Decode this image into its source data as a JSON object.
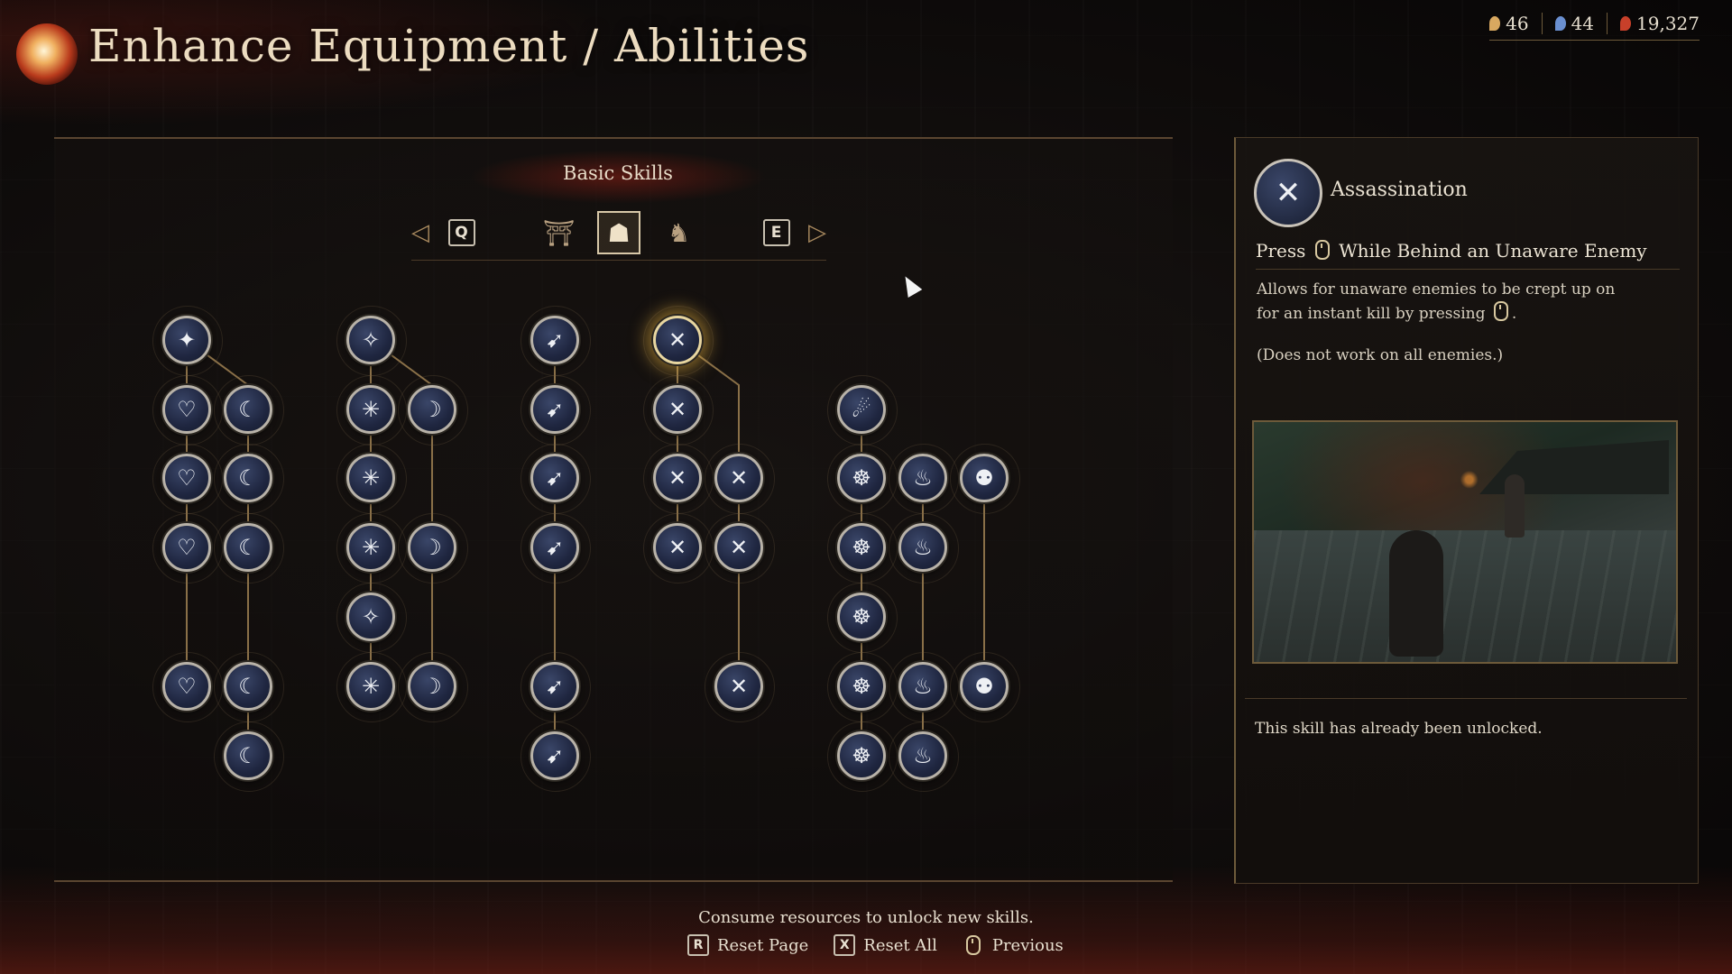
{
  "header": {
    "title": "Enhance Equipment / Abilities",
    "resources": [
      {
        "icon": "key-resource-icon",
        "value": "46",
        "color": "#d9a860"
      },
      {
        "icon": "blue-flame-resource-icon",
        "value": "44",
        "color": "#6a8fd0"
      },
      {
        "icon": "red-crystal-resource-icon",
        "value": "19,327",
        "color": "#c8402a"
      }
    ]
  },
  "skills": {
    "section_title": "Basic Skills",
    "tabs": {
      "prev_key": "Q",
      "next_key": "E",
      "items": [
        {
          "name": "tab-forge",
          "glyph": "⛩"
        },
        {
          "name": "tab-ninja",
          "glyph": "☗"
        },
        {
          "name": "tab-guardian",
          "glyph": "♞"
        }
      ],
      "active_index": 1
    },
    "columns": [
      {
        "glyph": "✦",
        "glyph_alt": "♡"
      },
      {
        "glyph": "✳",
        "glyph_alt": "☾"
      },
      {
        "glyph": "➹"
      },
      {
        "glyph": "✕"
      },
      {
        "glyph": "☸",
        "glyph_alt": "♨",
        "glyph_alt2": "⚉"
      }
    ],
    "nodes": [
      {
        "id": "n1",
        "col": 0,
        "g": "✦"
      },
      {
        "id": "n2",
        "col": 0,
        "g": "♡"
      },
      {
        "id": "n3",
        "col": 0,
        "g": "☾"
      },
      {
        "id": "n4",
        "col": 0,
        "g": "♡"
      },
      {
        "id": "n5",
        "col": 0,
        "g": "☾"
      },
      {
        "id": "n6",
        "col": 0,
        "g": "♡"
      },
      {
        "id": "n7",
        "col": 0,
        "g": "☾"
      },
      {
        "id": "n8",
        "col": 0,
        "g": "♡"
      },
      {
        "id": "n9",
        "col": 0,
        "g": "☾"
      },
      {
        "id": "n10",
        "col": 0,
        "g": "☾"
      },
      {
        "id": "n11",
        "col": 1,
        "g": "✧"
      },
      {
        "id": "n12",
        "col": 1,
        "g": "✳"
      },
      {
        "id": "n13",
        "col": 1,
        "g": "☽"
      },
      {
        "id": "n14",
        "col": 1,
        "g": "✳"
      },
      {
        "id": "n15",
        "col": 1,
        "g": "✳"
      },
      {
        "id": "n16",
        "col": 1,
        "g": "☽"
      },
      {
        "id": "n17",
        "col": 1,
        "g": "✧"
      },
      {
        "id": "n18",
        "col": 1,
        "g": "✳"
      },
      {
        "id": "n19",
        "col": 1,
        "g": "☽"
      },
      {
        "id": "n20",
        "col": 2,
        "g": "➹"
      },
      {
        "id": "n21",
        "col": 2,
        "g": "➹"
      },
      {
        "id": "n22",
        "col": 2,
        "g": "➹"
      },
      {
        "id": "n23",
        "col": 2,
        "g": "➹"
      },
      {
        "id": "n24",
        "col": 2,
        "g": "➹"
      },
      {
        "id": "n25",
        "col": 2,
        "g": "➹"
      },
      {
        "id": "n26",
        "col": 3,
        "g": "✕"
      },
      {
        "id": "n27",
        "col": 3,
        "g": "✕"
      },
      {
        "id": "n28",
        "col": 3,
        "g": "✕"
      },
      {
        "id": "n29",
        "col": 3,
        "g": "✕"
      },
      {
        "id": "n30",
        "col": 3,
        "g": "✕"
      },
      {
        "id": "n31",
        "col": 3,
        "g": "✕"
      },
      {
        "id": "n32",
        "col": 3,
        "g": "✕"
      },
      {
        "id": "n33",
        "col": 4,
        "g": "☄"
      },
      {
        "id": "n34",
        "col": 4,
        "g": "☸"
      },
      {
        "id": "n35",
        "col": 4,
        "g": "♨"
      },
      {
        "id": "n36",
        "col": 4,
        "g": "⚉"
      },
      {
        "id": "n37",
        "col": 4,
        "g": "☸"
      },
      {
        "id": "n38",
        "col": 4,
        "g": "♨"
      },
      {
        "id": "n39",
        "col": 4,
        "g": "☸"
      },
      {
        "id": "n40",
        "col": 4,
        "g": "☸"
      },
      {
        "id": "n41",
        "col": 4,
        "g": "♨"
      },
      {
        "id": "n42",
        "col": 4,
        "g": "⚉"
      },
      {
        "id": "n43",
        "col": 4,
        "g": "☸"
      },
      {
        "id": "n44",
        "col": 4,
        "g": "♨"
      }
    ],
    "selected": "n26"
  },
  "detail": {
    "name": "Assassination",
    "icon": "shuriken-icon",
    "action_prefix": "Press",
    "action_suffix": "While Behind an Unaware Enemy",
    "desc_line1": "Allows for unaware enemies to be crept up on",
    "desc_line2": "for an instant kill by pressing",
    "desc_end": ".",
    "note": "(Does not work on all enemies.)",
    "status": "This skill has already been unlocked."
  },
  "footer": {
    "message": "Consume resources to unlock new skills.",
    "controls": [
      {
        "key": "R",
        "label": "Reset Page"
      },
      {
        "key": "X",
        "label": "Reset All"
      },
      {
        "key": "mouse",
        "label": "Previous"
      }
    ]
  }
}
